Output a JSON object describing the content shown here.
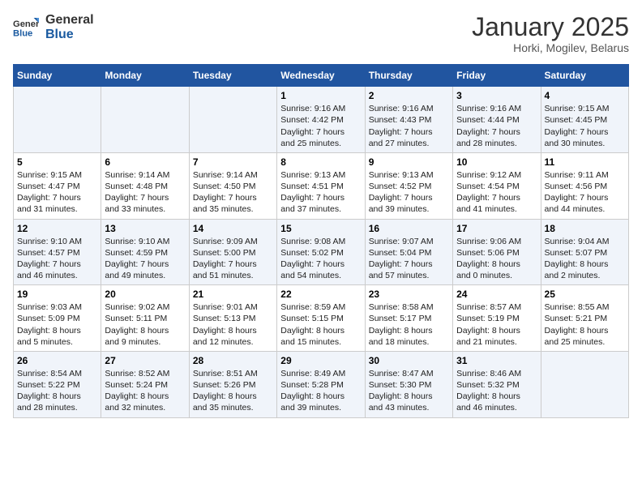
{
  "header": {
    "logo_general": "General",
    "logo_blue": "Blue",
    "title": "January 2025",
    "subtitle": "Horki, Mogilev, Belarus"
  },
  "weekdays": [
    "Sunday",
    "Monday",
    "Tuesday",
    "Wednesday",
    "Thursday",
    "Friday",
    "Saturday"
  ],
  "weeks": [
    [
      {
        "day": "",
        "info": ""
      },
      {
        "day": "",
        "info": ""
      },
      {
        "day": "",
        "info": ""
      },
      {
        "day": "1",
        "info": "Sunrise: 9:16 AM\nSunset: 4:42 PM\nDaylight: 7 hours\nand 25 minutes."
      },
      {
        "day": "2",
        "info": "Sunrise: 9:16 AM\nSunset: 4:43 PM\nDaylight: 7 hours\nand 27 minutes."
      },
      {
        "day": "3",
        "info": "Sunrise: 9:16 AM\nSunset: 4:44 PM\nDaylight: 7 hours\nand 28 minutes."
      },
      {
        "day": "4",
        "info": "Sunrise: 9:15 AM\nSunset: 4:45 PM\nDaylight: 7 hours\nand 30 minutes."
      }
    ],
    [
      {
        "day": "5",
        "info": "Sunrise: 9:15 AM\nSunset: 4:47 PM\nDaylight: 7 hours\nand 31 minutes."
      },
      {
        "day": "6",
        "info": "Sunrise: 9:14 AM\nSunset: 4:48 PM\nDaylight: 7 hours\nand 33 minutes."
      },
      {
        "day": "7",
        "info": "Sunrise: 9:14 AM\nSunset: 4:50 PM\nDaylight: 7 hours\nand 35 minutes."
      },
      {
        "day": "8",
        "info": "Sunrise: 9:13 AM\nSunset: 4:51 PM\nDaylight: 7 hours\nand 37 minutes."
      },
      {
        "day": "9",
        "info": "Sunrise: 9:13 AM\nSunset: 4:52 PM\nDaylight: 7 hours\nand 39 minutes."
      },
      {
        "day": "10",
        "info": "Sunrise: 9:12 AM\nSunset: 4:54 PM\nDaylight: 7 hours\nand 41 minutes."
      },
      {
        "day": "11",
        "info": "Sunrise: 9:11 AM\nSunset: 4:56 PM\nDaylight: 7 hours\nand 44 minutes."
      }
    ],
    [
      {
        "day": "12",
        "info": "Sunrise: 9:10 AM\nSunset: 4:57 PM\nDaylight: 7 hours\nand 46 minutes."
      },
      {
        "day": "13",
        "info": "Sunrise: 9:10 AM\nSunset: 4:59 PM\nDaylight: 7 hours\nand 49 minutes."
      },
      {
        "day": "14",
        "info": "Sunrise: 9:09 AM\nSunset: 5:00 PM\nDaylight: 7 hours\nand 51 minutes."
      },
      {
        "day": "15",
        "info": "Sunrise: 9:08 AM\nSunset: 5:02 PM\nDaylight: 7 hours\nand 54 minutes."
      },
      {
        "day": "16",
        "info": "Sunrise: 9:07 AM\nSunset: 5:04 PM\nDaylight: 7 hours\nand 57 minutes."
      },
      {
        "day": "17",
        "info": "Sunrise: 9:06 AM\nSunset: 5:06 PM\nDaylight: 8 hours\nand 0 minutes."
      },
      {
        "day": "18",
        "info": "Sunrise: 9:04 AM\nSunset: 5:07 PM\nDaylight: 8 hours\nand 2 minutes."
      }
    ],
    [
      {
        "day": "19",
        "info": "Sunrise: 9:03 AM\nSunset: 5:09 PM\nDaylight: 8 hours\nand 5 minutes."
      },
      {
        "day": "20",
        "info": "Sunrise: 9:02 AM\nSunset: 5:11 PM\nDaylight: 8 hours\nand 9 minutes."
      },
      {
        "day": "21",
        "info": "Sunrise: 9:01 AM\nSunset: 5:13 PM\nDaylight: 8 hours\nand 12 minutes."
      },
      {
        "day": "22",
        "info": "Sunrise: 8:59 AM\nSunset: 5:15 PM\nDaylight: 8 hours\nand 15 minutes."
      },
      {
        "day": "23",
        "info": "Sunrise: 8:58 AM\nSunset: 5:17 PM\nDaylight: 8 hours\nand 18 minutes."
      },
      {
        "day": "24",
        "info": "Sunrise: 8:57 AM\nSunset: 5:19 PM\nDaylight: 8 hours\nand 21 minutes."
      },
      {
        "day": "25",
        "info": "Sunrise: 8:55 AM\nSunset: 5:21 PM\nDaylight: 8 hours\nand 25 minutes."
      }
    ],
    [
      {
        "day": "26",
        "info": "Sunrise: 8:54 AM\nSunset: 5:22 PM\nDaylight: 8 hours\nand 28 minutes."
      },
      {
        "day": "27",
        "info": "Sunrise: 8:52 AM\nSunset: 5:24 PM\nDaylight: 8 hours\nand 32 minutes."
      },
      {
        "day": "28",
        "info": "Sunrise: 8:51 AM\nSunset: 5:26 PM\nDaylight: 8 hours\nand 35 minutes."
      },
      {
        "day": "29",
        "info": "Sunrise: 8:49 AM\nSunset: 5:28 PM\nDaylight: 8 hours\nand 39 minutes."
      },
      {
        "day": "30",
        "info": "Sunrise: 8:47 AM\nSunset: 5:30 PM\nDaylight: 8 hours\nand 43 minutes."
      },
      {
        "day": "31",
        "info": "Sunrise: 8:46 AM\nSunset: 5:32 PM\nDaylight: 8 hours\nand 46 minutes."
      },
      {
        "day": "",
        "info": ""
      }
    ]
  ]
}
